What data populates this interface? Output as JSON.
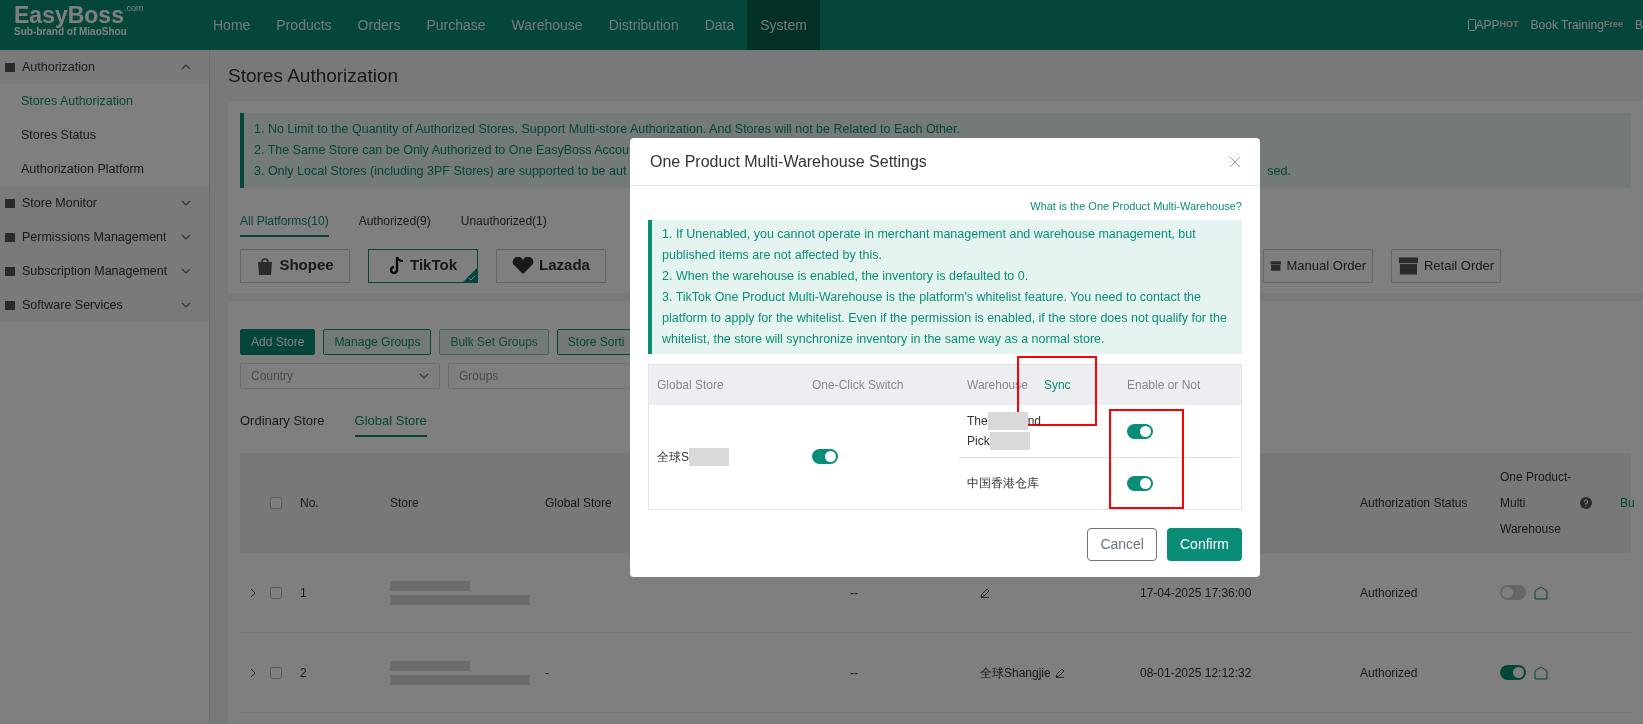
{
  "brand": {
    "name": "EasyBoss",
    "suffix": ".com",
    "tagline": "Sub-brand of MiaoShou"
  },
  "nav": [
    {
      "label": "Home",
      "selected": false
    },
    {
      "label": "Products",
      "selected": false
    },
    {
      "label": "Orders",
      "selected": false
    },
    {
      "label": "Purchase",
      "selected": false
    },
    {
      "label": "Warehouse",
      "selected": false
    },
    {
      "label": "Distribution",
      "selected": false
    },
    {
      "label": "Data",
      "selected": false
    },
    {
      "label": "System",
      "selected": true
    }
  ],
  "nav_right": [
    {
      "label": "APP",
      "badge": "HOT",
      "kind": "phone"
    },
    {
      "label": "Book Training",
      "badge": "Free",
      "kind": "plain"
    },
    {
      "label": "B",
      "kind": "plain"
    }
  ],
  "sidebar": [
    {
      "label": "Authorization",
      "expanded": true,
      "children": [
        {
          "label": "Stores Authorization",
          "selected": true
        },
        {
          "label": "Stores Status",
          "selected": false
        },
        {
          "label": "Authorization Platform",
          "selected": false
        }
      ]
    },
    {
      "label": "Store Monitor",
      "expanded": false
    },
    {
      "label": "Permissions Management",
      "expanded": false
    },
    {
      "label": "Subscription Management",
      "expanded": false
    },
    {
      "label": "Software Services",
      "expanded": false
    }
  ],
  "page_title": "Stores Authorization",
  "notice": [
    {
      "text": "1. No Limit to the Quantity of Authorized Stores. Support Multi-store Authorization. And Stores will not be Related to Each Other."
    },
    {
      "text": "2. The Same Store can be Only Authorized to One EasyBoss Accou"
    },
    {
      "text": "3. Only Local Stores (including 3PF Stores) are supported to be aut",
      "tail": "sed."
    }
  ],
  "platform_tabs": [
    {
      "label": "All Platforms(10)",
      "selected": true
    },
    {
      "label": "Authorized(9)",
      "selected": false
    },
    {
      "label": "Unauthorized(1)",
      "selected": false
    }
  ],
  "platforms": [
    {
      "label": "Shopee",
      "kind": "shopee",
      "selected": false
    },
    {
      "label": "TikTok",
      "kind": "tiktok",
      "selected": true
    },
    {
      "label": "Lazada",
      "kind": "lazada",
      "selected": false
    },
    {
      "label": "Manual Order",
      "kind": "store",
      "selected": false
    },
    {
      "label": "Retail Order",
      "kind": "store",
      "selected": false
    }
  ],
  "actions": [
    {
      "label": "Add Store",
      "kind": "primary",
      "disabled": false
    },
    {
      "label": "Manage Groups",
      "kind": "outline",
      "disabled": false
    },
    {
      "label": "Bulk Set Groups",
      "kind": "outline",
      "disabled": true
    },
    {
      "label": "Store Sorti",
      "kind": "outline",
      "disabled": false
    }
  ],
  "filters": [
    {
      "placeholder": "Country",
      "dropdown": true
    },
    {
      "placeholder": "Groups",
      "dropdown": false
    }
  ],
  "store_tabs": [
    {
      "label": "Ordinary Store",
      "selected": false
    },
    {
      "label": "Global Store",
      "selected": true
    }
  ],
  "table": {
    "header_checked": false,
    "columns": [
      {
        "label": "No.",
        "kind": "no"
      },
      {
        "label": "Store",
        "kind": "store"
      },
      {
        "label": "Global Store",
        "kind": "global_store"
      },
      {
        "label": "Authorization Status",
        "kind": "auth_status"
      },
      {
        "label": "One Product-Multi Warehouse",
        "kind": "multi_warehouse"
      },
      {
        "label": "Bu",
        "kind": "column_12"
      }
    ],
    "rows": [
      {
        "no": "1",
        "checked": false,
        "column_6": "--",
        "column_7": "",
        "time": "17-04-2025 17:36:00",
        "auth_status": "Authorized",
        "multi_warehouse_on": false
      },
      {
        "no": "2",
        "checked": false,
        "global_store": "-",
        "column_6": "--",
        "column_7": "全球Shangjie",
        "time": "08-01-2025 12:12:32",
        "auth_status": "Authorized",
        "multi_warehouse_on": true
      }
    ]
  },
  "modal": {
    "title": "One Product Multi-Warehouse Settings",
    "help_link": "What is the One Product Multi-Warehouse?",
    "notes": [
      "1. If Unenabled, you cannot operate in merchant management and warehouse management, but published items are not affected by this.",
      "2. When the warehouse is enabled, the inventory is defaulted to 0.",
      "3. TikTok One Product Multi-Warehouse is the platform's whitelist feature. You need to contact the platform to apply for the whitelist. Even if the permission is enabled, if the store does not qualify for the whitelist, the store will synchronize inventory in the same way as a normal store."
    ],
    "columns": {
      "store": "Global Store",
      "switch": "One-Click Switch",
      "warehouse": "Warehouse",
      "sync": "Sync",
      "enable": "Enable or Not"
    },
    "sync_highlighted": true,
    "enable_highlighted": true,
    "store": [
      {
        "kind": "text",
        "text": "全球S"
      },
      {
        "kind": "redacted"
      }
    ],
    "one_click_on": true,
    "warehouses": [
      {
        "lines": [
          [
            {
              "kind": "text",
              "text": "The"
            },
            {
              "kind": "redacted"
            },
            {
              "kind": "text",
              "text": "nd"
            }
          ],
          [
            {
              "kind": "text",
              "text": "Pick"
            },
            {
              "kind": "redacted"
            }
          ]
        ],
        "enabled": true
      },
      {
        "lines": [
          [
            {
              "kind": "text",
              "text": "中国香港仓库"
            }
          ]
        ],
        "enabled": true
      }
    ],
    "buttons": [
      {
        "label": "Cancel",
        "kind": "secondary"
      },
      {
        "label": "Confirm",
        "kind": "primary"
      }
    ]
  }
}
